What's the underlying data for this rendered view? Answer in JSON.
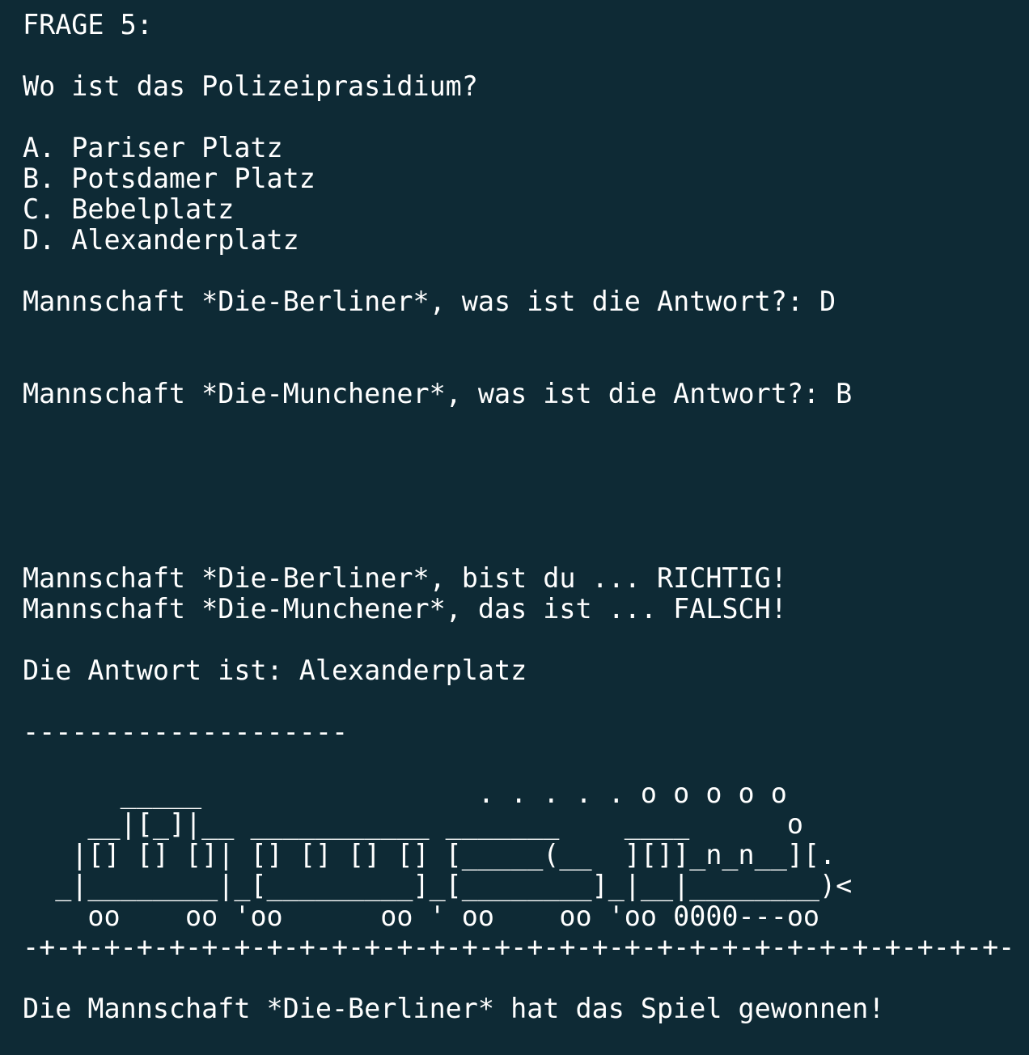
{
  "theme": {
    "background": "#0e2a35",
    "foreground": "#ffffff"
  },
  "question": {
    "header": "FRAGE 5:",
    "text": "Wo ist das Polizeiprasidium?",
    "options": [
      "A. Pariser Platz",
      "B. Potsdamer Platz",
      "C. Bebelplatz",
      "D. Alexanderplatz"
    ]
  },
  "prompts": {
    "team1": "Mannschaft *Die-Berliner*, was ist die Antwort?: D",
    "team2": "Mannschaft *Die-Munchener*, was ist die Antwort?: B"
  },
  "results": {
    "team1": "Mannschaft *Die-Berliner*, bist du ... RICHTIG!",
    "team2": "Mannschaft *Die-Munchener*, das ist ... FALSCH!",
    "answer": "Die Antwort ist: Alexanderplatz"
  },
  "separator": "--------------------",
  "train_art": [
    "      _____                 . . . . . o o o o o",
    "    __|[_]|__ ___________ _______    ____      o",
    "   |[] [] []| [] [] [] [] [_____(__  ][]]_n_n__][.",
    "  _|________|_[_________]_[________]_|__|________)<",
    "    oo    oo 'oo      oo ' oo    oo 'oo 0000---oo",
    "-+-+-+-+-+-+-+-+-+-+-+-+-+-+-+-+-+-+-+-+-+-+-+-+-+-+-+-+-+-+-"
  ],
  "winner": "Die Mannschaft *Die-Berliner* hat das Spiel gewonnen!"
}
